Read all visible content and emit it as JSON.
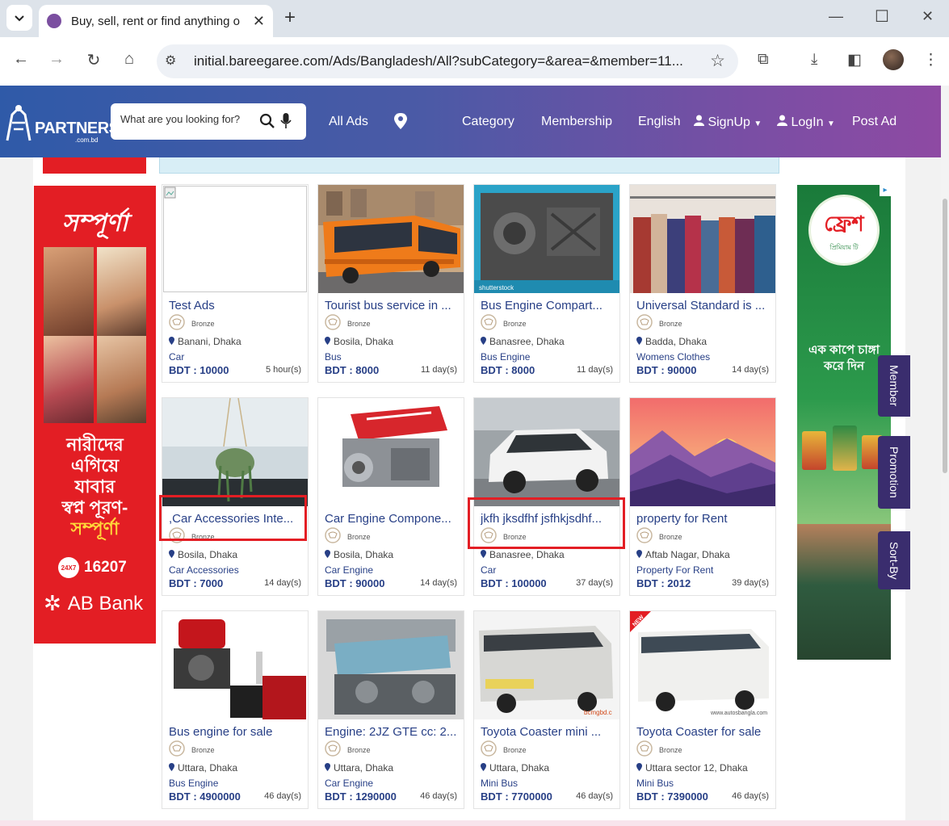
{
  "browser": {
    "tab_title": "Buy, sell, rent or find anything o",
    "url": "initial.bareegaree.com/Ads/Bangladesh/All?subCategory=&area=&member=11..."
  },
  "header": {
    "logo_text": "PARTNERS",
    "logo_sub": ".com.bd",
    "search_placeholder": "What are you looking for?",
    "nav": {
      "all_ads": "All Ads",
      "category": "Category",
      "membership": "Membership",
      "language": "English",
      "signup": "SignUp",
      "login": "LogIn",
      "post_ad": "Post Ad"
    },
    "colors": {
      "gradient_start": "#2f5aa8",
      "gradient_end": "#8e4aa3"
    }
  },
  "ads": {
    "left": {
      "brand": "সম্পূর্ণা",
      "line1": "নারীদের",
      "line2": "এগিয়ে",
      "line3": "যাবার",
      "line4": "স্বপ্ন পূরণ-",
      "line5": "সম্পূর্ণা",
      "hotline_badge": "24X7",
      "hotline": "16207",
      "bank": "AB Bank"
    },
    "right": {
      "brand": "ফ্রেশ",
      "brand_sub": "প্রিমিয়াম টি",
      "tagline": "এক কাপে চাঙ্গা করে দিন"
    }
  },
  "side_tabs": [
    "Member",
    "Promotion",
    "Sort-By"
  ],
  "listings": [
    {
      "title": "Test Ads",
      "badge": "Bronze",
      "location": "Banani, Dhaka",
      "category": "Car",
      "price": "BDT : 10000",
      "age": "5 hour(s)",
      "image": "broken-image"
    },
    {
      "title": "Tourist bus service in ...",
      "badge": "Bronze",
      "location": "Bosila, Dhaka",
      "category": "Bus",
      "price": "BDT : 8000",
      "age": "11 day(s)",
      "image": "orange-bus"
    },
    {
      "title": "Bus Engine Compart...",
      "badge": "Bronze",
      "location": "Banasree, Dhaka",
      "category": "Bus Engine",
      "price": "BDT : 8000",
      "age": "11 day(s)",
      "image": "bus-engine"
    },
    {
      "title": "Universal Standard is ...",
      "badge": "Bronze",
      "location": "Badda, Dhaka",
      "category": "Womens Clothes",
      "price": "BDT : 90000",
      "age": "14 day(s)",
      "image": "clothes-rack"
    },
    {
      "title": ",Car Accessories Inte...",
      "badge": "Bronze",
      "location": "Bosila, Dhaka",
      "category": "Car Accessories",
      "price": "BDT : 7000",
      "age": "14 day(s)",
      "image": "car-plant-hanger"
    },
    {
      "title": "Car Engine Compone...",
      "badge": "Bronze",
      "location": "Bosila, Dhaka",
      "category": "Car Engine",
      "price": "BDT : 90000",
      "age": "14 day(s)",
      "image": "red-engine"
    },
    {
      "title": "jkfh jksdfhf jsfhkjsdhf...",
      "badge": "Bronze",
      "location": "Banasree, Dhaka",
      "category": "Car",
      "price": "BDT : 100000",
      "age": "37 day(s)",
      "image": "white-suv"
    },
    {
      "title": "property for Rent",
      "badge": "Bronze",
      "location": "Aftab Nagar, Dhaka",
      "category": "Property For Rent",
      "price": "BDT : 2012",
      "age": "39 day(s)",
      "image": "mountain-sunset"
    },
    {
      "title": "Bus engine for sale",
      "badge": "Bronze",
      "location": "Uttara, Dhaka",
      "category": "Bus Engine",
      "price": "BDT : 4900000",
      "age": "46 day(s)",
      "image": "red-generator"
    },
    {
      "title": "Engine: 2JZ GTE cc: 2...",
      "badge": "Bronze",
      "location": "Uttara, Dhaka",
      "category": "Car Engine",
      "price": "BDT : 1290000",
      "age": "46 day(s)",
      "image": "blue-engine"
    },
    {
      "title": "Toyota Coaster mini ...",
      "badge": "Bronze",
      "location": "Uttara, Dhaka",
      "category": "Mini Bus",
      "price": "BDT : 7700000",
      "age": "46 day(s)",
      "image": "coaster-grey"
    },
    {
      "title": "Toyota Coaster for sale",
      "badge": "Bronze",
      "location": "Uttara sector 12, Dhaka",
      "category": "Mini Bus",
      "price": "BDT : 7390000",
      "age": "46 day(s)",
      "image": "coaster-white"
    }
  ],
  "image_captions": {
    "bus_engine": "shutterstock",
    "coaster_grey": "bcmgbd.c",
    "coaster_white": "www.autosbangla.com",
    "new_ribbon": "NEW"
  },
  "highlight_color": "#e31e24"
}
